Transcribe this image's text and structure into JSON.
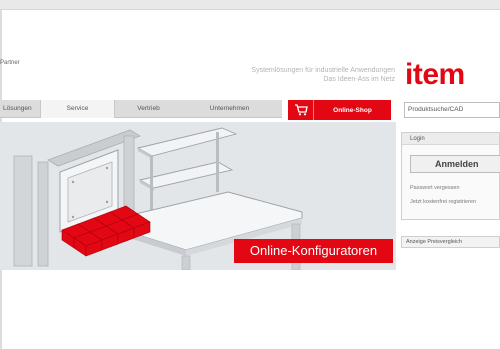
{
  "header": {
    "partner_text": "Partner",
    "tagline_line1": "Systemlösungen für industrielle Anwendungen",
    "tagline_line2": "Das Ideen-Ass im Netz",
    "logo_text": "item",
    "brand_color": "#e30613"
  },
  "nav": {
    "items": [
      {
        "label": "Lösungen",
        "active": false
      },
      {
        "label": "Service",
        "active": true
      },
      {
        "label": "Vertrieb",
        "active": false
      },
      {
        "label": "Unternehmen",
        "active": false
      }
    ]
  },
  "shop": {
    "label": "Online-Shop",
    "icon": "shopping-cart-icon"
  },
  "search": {
    "value": "Produktsuche/CAD"
  },
  "hero": {
    "badge": "Online-Konfiguratoren"
  },
  "login": {
    "header": "Login",
    "button_label": "Anmelden",
    "link_forgot": "Passwort vergessen",
    "link_register": "Jetzt kostenfrei registrieren"
  },
  "filter": {
    "label": "Anzeige Preisvergleich"
  }
}
